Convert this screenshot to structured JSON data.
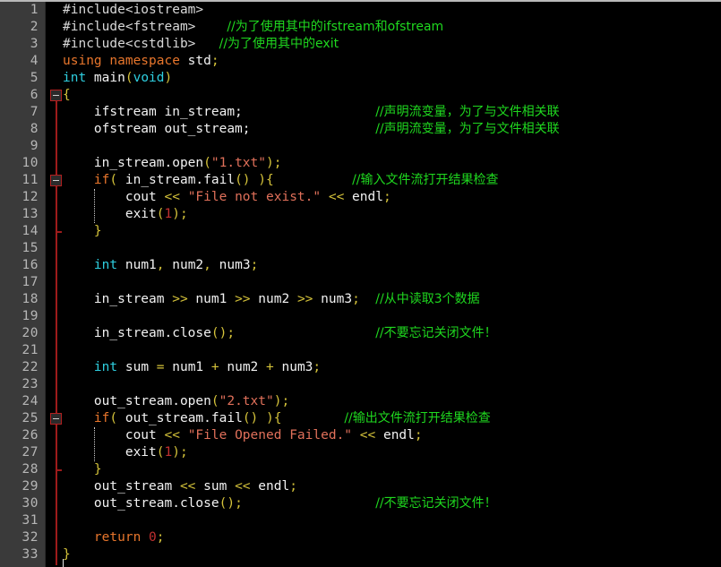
{
  "editor": {
    "title": "C++ source code editor",
    "language": "cpp",
    "total_lines": 33,
    "line_height": 19,
    "gutter_width": 50,
    "colors": {
      "background": "#000000",
      "gutter_background": "#3a3a3a",
      "line_number": "#b6b6b6",
      "fold_marker": "#b02020",
      "keyword": "#e8762c",
      "type": "#2ecfe0",
      "identifier": "#f2f2f2",
      "string": "#e0705a",
      "number": "#c03030",
      "punctuation": "#d4c23a",
      "operator": "#d4c23a",
      "comment": "#1fd81f",
      "preprocessor": "#d8d8d8",
      "top_border": "#b9b9b9"
    }
  },
  "line_numbers": [
    "1",
    "2",
    "3",
    "4",
    "5",
    "6",
    "7",
    "8",
    "9",
    "10",
    "11",
    "12",
    "13",
    "14",
    "15",
    "16",
    "17",
    "18",
    "19",
    "20",
    "21",
    "22",
    "23",
    "24",
    "25",
    "26",
    "27",
    "28",
    "29",
    "30",
    "31",
    "32",
    "33"
  ],
  "fold_markers": [
    {
      "line": 6,
      "state": "expanded"
    },
    {
      "line": 11,
      "state": "expanded"
    },
    {
      "line": 25,
      "state": "expanded"
    }
  ],
  "fold_ends": [
    14,
    28
  ],
  "code_lines": [
    {
      "n": 1,
      "indent": 0,
      "tokens": [
        {
          "t": "#include<iostream>",
          "c": "pre"
        }
      ]
    },
    {
      "n": 2,
      "indent": 0,
      "tokens": [
        {
          "t": "#include<fstream>",
          "c": "pre"
        },
        {
          "t": "    ",
          "c": "id"
        },
        {
          "t": "//为了使用其中的ifstream和ofstream",
          "c": "cmt"
        }
      ]
    },
    {
      "n": 3,
      "indent": 0,
      "tokens": [
        {
          "t": "#include<cstdlib>",
          "c": "pre"
        },
        {
          "t": "   ",
          "c": "id"
        },
        {
          "t": "//为了使用其中的exit",
          "c": "cmt"
        }
      ]
    },
    {
      "n": 4,
      "indent": 0,
      "tokens": [
        {
          "t": "using namespace",
          "c": "kw"
        },
        {
          "t": " std",
          "c": "id"
        },
        {
          "t": ";",
          "c": "punc"
        }
      ]
    },
    {
      "n": 5,
      "indent": 0,
      "tokens": [
        {
          "t": "int",
          "c": "type"
        },
        {
          "t": " main",
          "c": "id"
        },
        {
          "t": "(",
          "c": "punc"
        },
        {
          "t": "void",
          "c": "type"
        },
        {
          "t": ")",
          "c": "punc"
        }
      ]
    },
    {
      "n": 6,
      "indent": 0,
      "tokens": [
        {
          "t": "{",
          "c": "punc"
        }
      ]
    },
    {
      "n": 7,
      "indent": 0,
      "tokens": [
        {
          "t": "    ifstream in_stream;",
          "c": "id"
        },
        {
          "t": "                 ",
          "c": "id"
        },
        {
          "t": "//声明流变量，为了与文件相关联",
          "c": "cmt"
        }
      ]
    },
    {
      "n": 8,
      "indent": 0,
      "tokens": [
        {
          "t": "    ofstream out_stream;",
          "c": "id"
        },
        {
          "t": "                ",
          "c": "id"
        },
        {
          "t": "//声明流变量，为了与文件相关联",
          "c": "cmt"
        }
      ]
    },
    {
      "n": 9,
      "indent": 0,
      "tokens": []
    },
    {
      "n": 10,
      "indent": 0,
      "tokens": [
        {
          "t": "    in_stream.open",
          "c": "id"
        },
        {
          "t": "(",
          "c": "punc"
        },
        {
          "t": "\"1.txt\"",
          "c": "str"
        },
        {
          "t": ")",
          "c": "punc"
        },
        {
          "t": ";",
          "c": "punc"
        }
      ]
    },
    {
      "n": 11,
      "indent": 0,
      "tokens": [
        {
          "t": "    ",
          "c": "id"
        },
        {
          "t": "if",
          "c": "kw"
        },
        {
          "t": "(",
          "c": "punc"
        },
        {
          "t": " in_stream.fail",
          "c": "id"
        },
        {
          "t": "()",
          "c": "punc"
        },
        {
          "t": " ",
          "c": "id"
        },
        {
          "t": ")",
          "c": "punc"
        },
        {
          "t": "{",
          "c": "punc"
        },
        {
          "t": "          ",
          "c": "id"
        },
        {
          "t": "//输入文件流打开结果检查",
          "c": "cmt"
        }
      ]
    },
    {
      "n": 12,
      "indent": 0,
      "tokens": [
        {
          "t": "        cout ",
          "c": "id"
        },
        {
          "t": "<<",
          "c": "op"
        },
        {
          "t": " ",
          "c": "id"
        },
        {
          "t": "\"File not exist.\"",
          "c": "str"
        },
        {
          "t": " ",
          "c": "id"
        },
        {
          "t": "<<",
          "c": "op"
        },
        {
          "t": " endl",
          "c": "id"
        },
        {
          "t": ";",
          "c": "punc"
        }
      ]
    },
    {
      "n": 13,
      "indent": 0,
      "tokens": [
        {
          "t": "        exit",
          "c": "id"
        },
        {
          "t": "(",
          "c": "punc"
        },
        {
          "t": "1",
          "c": "num"
        },
        {
          "t": ")",
          "c": "punc"
        },
        {
          "t": ";",
          "c": "punc"
        }
      ]
    },
    {
      "n": 14,
      "indent": 0,
      "tokens": [
        {
          "t": "    ",
          "c": "id"
        },
        {
          "t": "}",
          "c": "punc"
        }
      ]
    },
    {
      "n": 15,
      "indent": 0,
      "tokens": []
    },
    {
      "n": 16,
      "indent": 0,
      "tokens": [
        {
          "t": "    ",
          "c": "id"
        },
        {
          "t": "int",
          "c": "type"
        },
        {
          "t": " num1",
          "c": "id"
        },
        {
          "t": ",",
          "c": "punc"
        },
        {
          "t": " num2",
          "c": "id"
        },
        {
          "t": ",",
          "c": "punc"
        },
        {
          "t": " num3",
          "c": "id"
        },
        {
          "t": ";",
          "c": "punc"
        }
      ]
    },
    {
      "n": 17,
      "indent": 0,
      "tokens": []
    },
    {
      "n": 18,
      "indent": 0,
      "tokens": [
        {
          "t": "    in_stream ",
          "c": "id"
        },
        {
          "t": ">>",
          "c": "op"
        },
        {
          "t": " num1 ",
          "c": "id"
        },
        {
          "t": ">>",
          "c": "op"
        },
        {
          "t": " num2 ",
          "c": "id"
        },
        {
          "t": ">>",
          "c": "op"
        },
        {
          "t": " num3",
          "c": "id"
        },
        {
          "t": ";",
          "c": "punc"
        },
        {
          "t": "  ",
          "c": "id"
        },
        {
          "t": "//从中读取3个数据",
          "c": "cmt"
        }
      ]
    },
    {
      "n": 19,
      "indent": 0,
      "tokens": []
    },
    {
      "n": 20,
      "indent": 0,
      "tokens": [
        {
          "t": "    in_stream.close",
          "c": "id"
        },
        {
          "t": "()",
          "c": "punc"
        },
        {
          "t": ";",
          "c": "punc"
        },
        {
          "t": "                  ",
          "c": "id"
        },
        {
          "t": "//不要忘记关闭文件！",
          "c": "cmt"
        }
      ]
    },
    {
      "n": 21,
      "indent": 0,
      "tokens": []
    },
    {
      "n": 22,
      "indent": 0,
      "tokens": [
        {
          "t": "    ",
          "c": "id"
        },
        {
          "t": "int",
          "c": "type"
        },
        {
          "t": " sum ",
          "c": "id"
        },
        {
          "t": "=",
          "c": "op"
        },
        {
          "t": " num1 ",
          "c": "id"
        },
        {
          "t": "+",
          "c": "op"
        },
        {
          "t": " num2 ",
          "c": "id"
        },
        {
          "t": "+",
          "c": "op"
        },
        {
          "t": " num3",
          "c": "id"
        },
        {
          "t": ";",
          "c": "punc"
        }
      ]
    },
    {
      "n": 23,
      "indent": 0,
      "tokens": []
    },
    {
      "n": 24,
      "indent": 0,
      "tokens": [
        {
          "t": "    out_stream.open",
          "c": "id"
        },
        {
          "t": "(",
          "c": "punc"
        },
        {
          "t": "\"2.txt\"",
          "c": "str"
        },
        {
          "t": ")",
          "c": "punc"
        },
        {
          "t": ";",
          "c": "punc"
        }
      ]
    },
    {
      "n": 25,
      "indent": 0,
      "tokens": [
        {
          "t": "    ",
          "c": "id"
        },
        {
          "t": "if",
          "c": "kw"
        },
        {
          "t": "(",
          "c": "punc"
        },
        {
          "t": " out_stream.fail",
          "c": "id"
        },
        {
          "t": "()",
          "c": "punc"
        },
        {
          "t": " ",
          "c": "id"
        },
        {
          "t": ")",
          "c": "punc"
        },
        {
          "t": "{",
          "c": "punc"
        },
        {
          "t": "        ",
          "c": "id"
        },
        {
          "t": "//输出文件流打开结果检查",
          "c": "cmt"
        }
      ]
    },
    {
      "n": 26,
      "indent": 0,
      "tokens": [
        {
          "t": "        cout ",
          "c": "id"
        },
        {
          "t": "<<",
          "c": "op"
        },
        {
          "t": " ",
          "c": "id"
        },
        {
          "t": "\"File Opened Failed.\"",
          "c": "str"
        },
        {
          "t": " ",
          "c": "id"
        },
        {
          "t": "<<",
          "c": "op"
        },
        {
          "t": " endl",
          "c": "id"
        },
        {
          "t": ";",
          "c": "punc"
        }
      ]
    },
    {
      "n": 27,
      "indent": 0,
      "tokens": [
        {
          "t": "        exit",
          "c": "id"
        },
        {
          "t": "(",
          "c": "punc"
        },
        {
          "t": "1",
          "c": "num"
        },
        {
          "t": ")",
          "c": "punc"
        },
        {
          "t": ";",
          "c": "punc"
        }
      ]
    },
    {
      "n": 28,
      "indent": 0,
      "tokens": [
        {
          "t": "    ",
          "c": "id"
        },
        {
          "t": "}",
          "c": "punc"
        }
      ]
    },
    {
      "n": 29,
      "indent": 0,
      "tokens": [
        {
          "t": "    out_stream ",
          "c": "id"
        },
        {
          "t": "<<",
          "c": "op"
        },
        {
          "t": " sum ",
          "c": "id"
        },
        {
          "t": "<<",
          "c": "op"
        },
        {
          "t": " endl",
          "c": "id"
        },
        {
          "t": ";",
          "c": "punc"
        }
      ]
    },
    {
      "n": 30,
      "indent": 0,
      "tokens": [
        {
          "t": "    out_stream.close",
          "c": "id"
        },
        {
          "t": "()",
          "c": "punc"
        },
        {
          "t": ";",
          "c": "punc"
        },
        {
          "t": "                 ",
          "c": "id"
        },
        {
          "t": "//不要忘记关闭文件！",
          "c": "cmt"
        }
      ]
    },
    {
      "n": 31,
      "indent": 0,
      "tokens": []
    },
    {
      "n": 32,
      "indent": 0,
      "tokens": [
        {
          "t": "    ",
          "c": "id"
        },
        {
          "t": "return",
          "c": "kw"
        },
        {
          "t": " ",
          "c": "id"
        },
        {
          "t": "0",
          "c": "num"
        },
        {
          "t": ";",
          "c": "punc"
        }
      ]
    },
    {
      "n": 33,
      "indent": 0,
      "tokens": [
        {
          "t": "}",
          "c": "punc"
        }
      ]
    }
  ],
  "indent_guides": [
    {
      "from_line": 12,
      "to_line": 13,
      "col": 4
    },
    {
      "from_line": 26,
      "to_line": 27,
      "col": 4
    }
  ],
  "caret": {
    "line": 33,
    "col": 0
  }
}
